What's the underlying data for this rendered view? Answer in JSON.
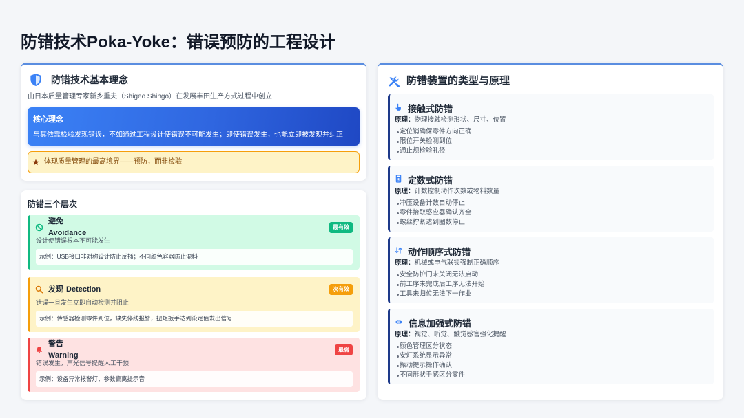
{
  "page": {
    "title": "防错技术Poka-Yoke：错误预防的工程设计"
  },
  "philosophy": {
    "icon": "shield-halved-icon",
    "heading": "防错技术基本理念",
    "origin": "由日本质量管理专家新乡重夫（Shigeo Shingo）在发展丰田生产方式过程中创立",
    "core": {
      "label": "核心理念",
      "text": "与其依靠检验发现错误，不如通过工程设计使错误不可能发生；即使错误发生，也能立即被发现并纠正"
    },
    "highlight": {
      "icon": "star-icon",
      "text": "体现质量管理的最高境界——预防，而非检验"
    }
  },
  "levels": {
    "heading": "防错三个层次",
    "items": [
      {
        "icon": "ban-icon",
        "name_zh": "避免",
        "name_en": "Avoidance",
        "badge": "最有效",
        "description": "设计使错误根本不可能发生",
        "example": "示例：USB接口非对称设计防止反插；不同颜色容器防止混料",
        "accent": "#10b981",
        "background": "#d1fae5"
      },
      {
        "icon": "search-icon",
        "name_zh": "发现",
        "name_en": "Detection",
        "badge": "次有效",
        "description": "错误一旦发生立即自动检测并阻止",
        "example": "示例：传感器检测零件到位，缺失停线报警，扭矩扳手达到设定值发出信号",
        "accent": "#f59e0b",
        "background": "#fef3c7"
      },
      {
        "icon": "bell-icon",
        "name_zh": "警告",
        "name_en": "Warning",
        "badge": "最弱",
        "description": "错误发生，声光信号提醒人工干预",
        "example": "示例：设备异常报警灯，参数偏离提示音",
        "accent": "#ef4444",
        "background": "#fee2e2"
      }
    ]
  },
  "devices": {
    "icon": "screwdriver-wrench-icon",
    "heading": "防错装置的类型与原理",
    "principle_label": "原理：",
    "items": [
      {
        "icon": "hand-pointer-icon",
        "name": "接触式防错",
        "principle": "物理接触检测形状、尺寸、位置",
        "points": [
          "定位销确保零件方向正确",
          "限位开关检测到位",
          "通止规检验孔径"
        ]
      },
      {
        "icon": "calculator-icon",
        "name": "定数式防错",
        "principle": "计数控制动作次数或物料数量",
        "points": [
          "冲压设备计数自动停止",
          "零件拾取感应器确认齐全",
          "螺丝拧紧达到圈数停止"
        ]
      },
      {
        "icon": "arrows-up-down-icon",
        "name": "动作顺序式防错",
        "principle": "机械或电气联锁强制正确顺序",
        "points": [
          "安全防护门未关闭无法启动",
          "前工序未完成后工序无法开始",
          "工具未归位无法下一作业"
        ]
      },
      {
        "icon": "eye-icon",
        "name": "信息加强式防错",
        "principle": "视觉、听觉、触觉感官强化提醒",
        "points": [
          "颜色管理区分状态",
          "安灯系统显示异常",
          "振动提示操作确认",
          "不同形状手感区分零件"
        ]
      }
    ]
  },
  "colors": {
    "primary": "#3b82f6",
    "panel_border": "#5a8de0",
    "device_border": "#1e3a8a",
    "highlight_bg": "#fef3c7",
    "highlight_border": "#f59e0b"
  }
}
